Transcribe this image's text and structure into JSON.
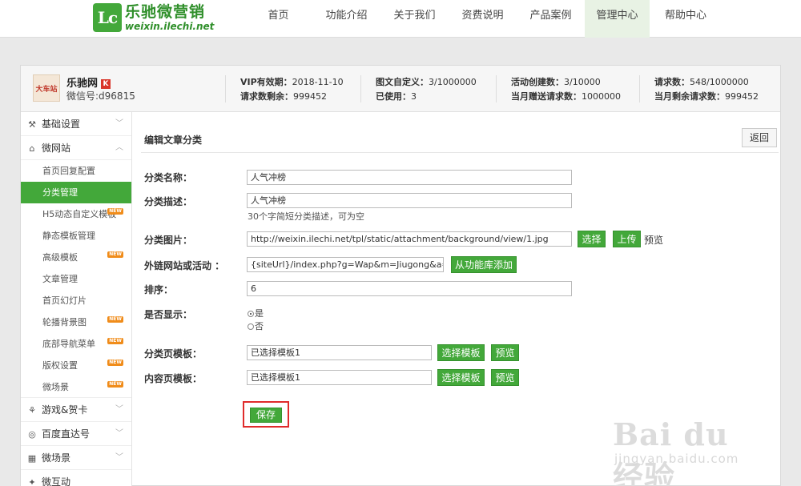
{
  "brand": {
    "logo_mark": "Lc",
    "name": "乐驰微营销",
    "domain": "weixin.ilechi.net",
    "green": "#43a83a"
  },
  "nav": {
    "items": [
      "首页",
      "功能介绍",
      "关于我们",
      "资费说明",
      "产品案例",
      "管理中心",
      "帮助中心"
    ],
    "active": "管理中心"
  },
  "account": {
    "avatar_text": "大车站",
    "name": "乐驰网",
    "badge": "K",
    "wechat_id": "微信号:d96815",
    "stats": [
      {
        "label1": "VIP有效期：",
        "value1": "2018-11-10",
        "label2": "请求数剩余：",
        "value2": "999452"
      },
      {
        "label1": "图文自定义：",
        "value1": "3/1000000",
        "label2": "已使用：",
        "value2": "3"
      },
      {
        "label1": "活动创建数：",
        "value1": "3/10000",
        "label2": "当月赠送请求数：",
        "value2": "1000000"
      },
      {
        "label1": "请求数：",
        "value1": "548/1000000",
        "label2": "当月剩余请求数：",
        "value2": "999452"
      }
    ]
  },
  "sidebar": {
    "sections": [
      {
        "icon": "wrench-icon",
        "glyph": "⚒",
        "label": "基础设置"
      },
      {
        "icon": "home-icon",
        "glyph": "⌂",
        "label": "微网站"
      },
      {
        "icon": "gamepad-icon",
        "glyph": "⚘",
        "label": "游戏&贺卡"
      },
      {
        "icon": "baidu-icon",
        "glyph": "◎",
        "label": "百度直达号"
      },
      {
        "icon": "scene-icon",
        "glyph": "▦",
        "label": "微场景"
      }
    ],
    "sub_items": [
      {
        "label": "首页回复配置",
        "new": false
      },
      {
        "label": "分类管理",
        "new": false
      },
      {
        "label": "H5动态自定义模板",
        "new": true
      },
      {
        "label": "静态模板管理",
        "new": false
      },
      {
        "label": "高级模板",
        "new": true
      },
      {
        "label": "文章管理",
        "new": false
      },
      {
        "label": "首页幻灯片",
        "new": false
      },
      {
        "label": "轮播背景图",
        "new": true
      },
      {
        "label": "底部导航菜单",
        "new": true
      },
      {
        "label": "版权设置",
        "new": true
      },
      {
        "label": "微场景",
        "new": true
      }
    ],
    "new_badge": "NEW",
    "partial_item": "微互动"
  },
  "form": {
    "title": "编辑文章分类",
    "back_label": "返回",
    "name_label": "分类名称：",
    "name_value": "人气冲榜",
    "desc_label": "分类描述：",
    "desc_value": "人气冲榜",
    "desc_hint": "30个字简短分类描述，可为空",
    "image_label": "分类图片：",
    "image_value": "http://weixin.ilechi.net/tpl/static/attachment/background/view/1.jpg",
    "choose_label": "选择",
    "upload_label": "上传",
    "preview_label": "预览",
    "link_label": "外链网站或活动 ：",
    "link_value": "{siteUrl}/index.php?g=Wap&m=Jiugong&a=in",
    "from_lib_label": "从功能库添加",
    "sort_label": "排序：",
    "sort_value": "6",
    "show_label": "是否显示：",
    "show_yes": "是",
    "show_no": "否",
    "cat_tpl_label": "分类页模板：",
    "cat_tpl_value": "已选择模板1",
    "content_tpl_label": "内容页模板：",
    "content_tpl_value": "已选择模板1",
    "choose_tpl_label": "选择模板",
    "save_label": "保存"
  },
  "watermark": {
    "main": "Bai du 经验",
    "sub": "jingyan.baidu.com"
  }
}
